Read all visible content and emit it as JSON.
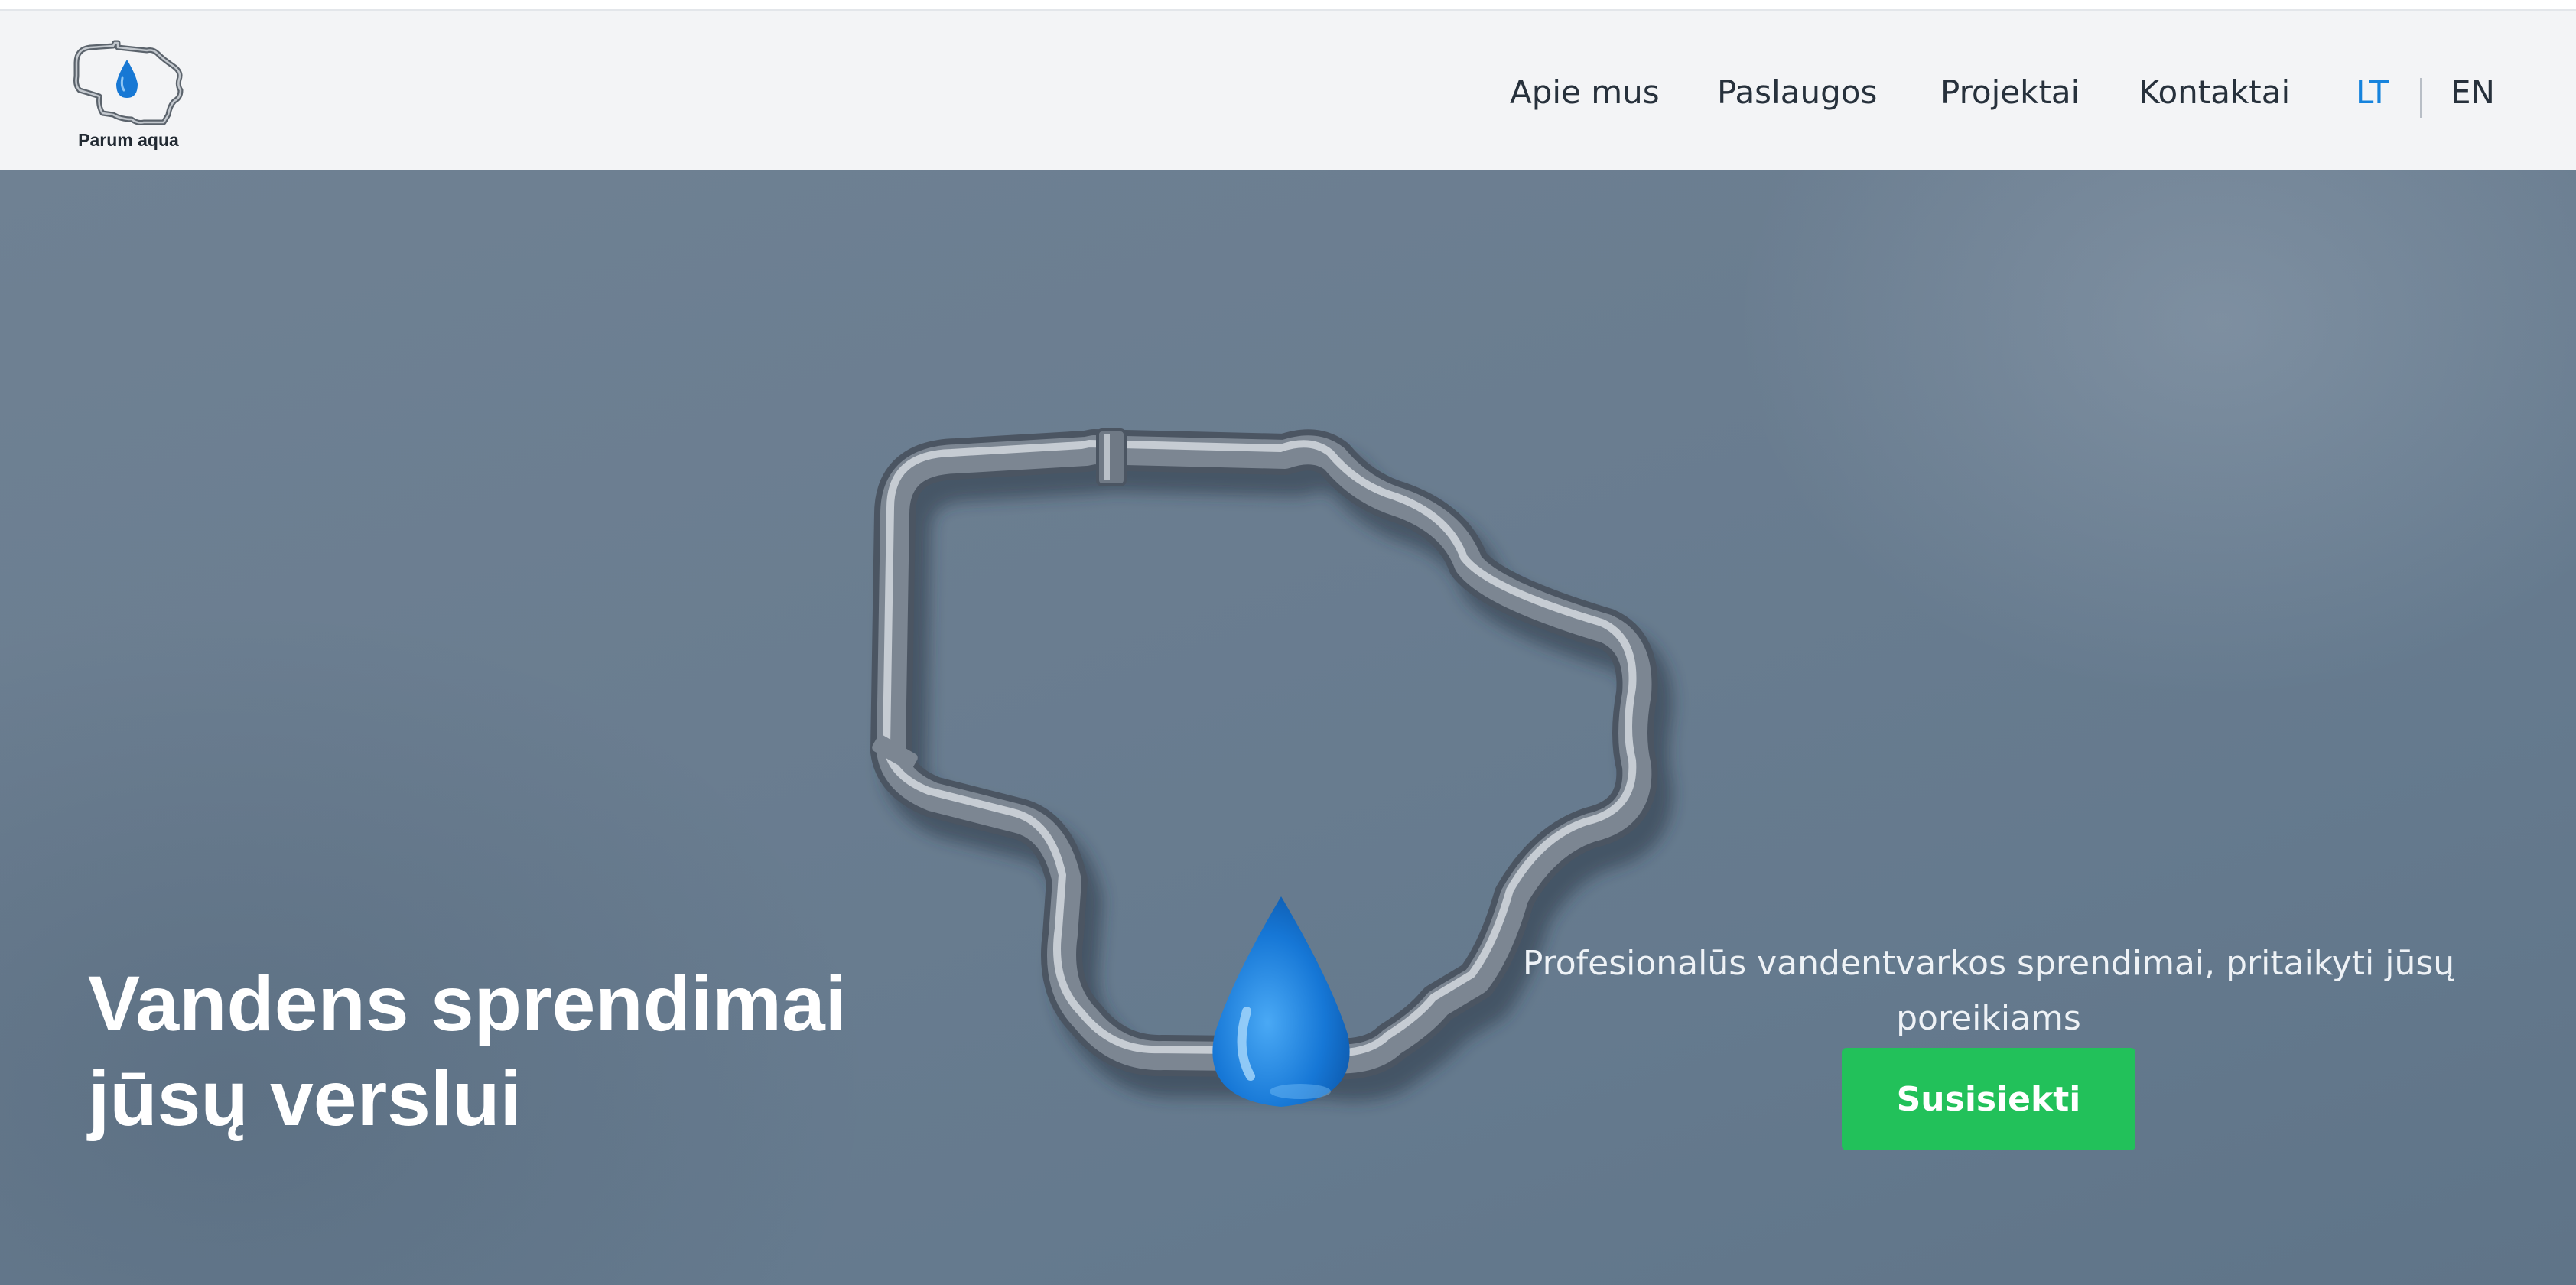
{
  "brand": {
    "name": "Parum aqua",
    "logo_icon": "lithuania-pipe-water-drop-logo"
  },
  "nav": {
    "items": [
      {
        "label": "Apie mus"
      },
      {
        "label": "Paslaugos"
      },
      {
        "label": "Projektai"
      },
      {
        "label": "Kontaktai"
      }
    ],
    "languages": [
      {
        "label": "LT",
        "active": true
      },
      {
        "label": "EN",
        "active": false
      }
    ]
  },
  "hero": {
    "title_line1": "Vandens sprendimai",
    "title_line2": "jūsų verslui",
    "subtitle": "Profesionalūs vandentvarkos sprendimai, pritaikyti jūsų poreikiams",
    "cta_label": "Susisiekti",
    "image_icon": "lithuania-shaped-pipe-with-water-drop"
  },
  "colors": {
    "accent_blue": "#1683dd",
    "cta_green": "#22c15a",
    "hero_background": "#6a7d90",
    "header_background": "#f3f4f6"
  }
}
